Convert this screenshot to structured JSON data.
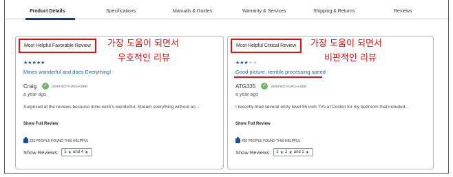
{
  "tabs": [
    {
      "label": "Product Details",
      "active": true
    },
    {
      "label": "Specifications",
      "active": false
    },
    {
      "label": "Manuals & Guides",
      "active": false
    },
    {
      "label": "Warranty & Services",
      "active": false
    },
    {
      "label": "Shipping & Returns",
      "active": false
    },
    {
      "label": "Reviews",
      "active": false
    }
  ],
  "colors": {
    "accent": "#1f4f9c",
    "annotation": "#e01010",
    "link": "#1f5fb5",
    "verified": "#6fb86b"
  },
  "favorable": {
    "heading": "Most Helpful Favorable Review",
    "annotation_line1": "가장 도움이 되면서",
    "annotation_line2": "우호적인 리뷰",
    "rating": 5,
    "stars_on": "★★★★★",
    "stars_off": "",
    "title": "Mines wonderful and does Everything!",
    "author": "Craig",
    "verified_icon": "check-icon",
    "verified_label": "VERIFIED PURCHASER",
    "time": "a year ago",
    "excerpt": "Surprised at the reviews because mine work's wonderful. Stream everything without an...",
    "show_full": "Show Full Review",
    "helpful_text": "223 PEOPLE FOUND THIS HELPFUL",
    "show_reviews_label": "Show Reviews:",
    "filter_a": "5",
    "filter_mid": "and 4",
    "star_glyph": "★"
  },
  "critical": {
    "heading": "Most Helpful Critical Review",
    "annotation_line1": "가장 도움이 되면서",
    "annotation_line2": "비판적인 리뷰",
    "rating": 3,
    "stars_on": "★★★",
    "stars_off": "★★",
    "title": "Good picture, terrible processing speed",
    "author": "ATG335",
    "verified_icon": "check-icon",
    "verified_label": "VERIFIED PURCHASER",
    "time": "a year ago",
    "excerpt": "I recently tried several entry level 55 inch TVs at Costco for my bedroom that included...",
    "show_full": "Show Full Review",
    "helpful_text": "455 PEOPLE FOUND THIS HELPFUL",
    "show_reviews_label": "Show Reviews:",
    "filter_a": "3",
    "filter_b": "2",
    "filter_mid": "and 1",
    "star_glyph": "★"
  }
}
